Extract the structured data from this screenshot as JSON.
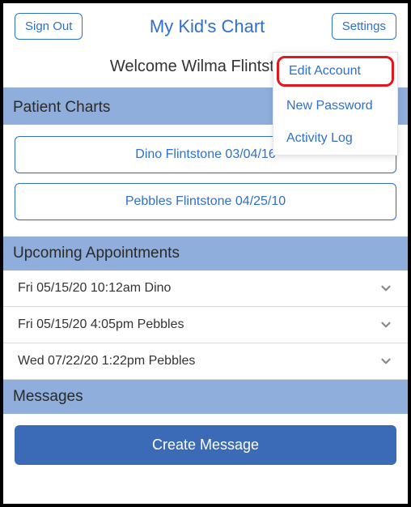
{
  "header": {
    "sign_out": "Sign Out",
    "title": "My Kid's Chart",
    "settings": "Settings"
  },
  "welcome": "Welcome Wilma Flintstone",
  "dropdown": {
    "edit_account": "Edit Account",
    "new_password": "New Password",
    "activity_log": "Activity Log"
  },
  "sections": {
    "patient_charts": "Patient Charts",
    "upcoming_appointments": "Upcoming Appointments",
    "messages": "Messages"
  },
  "patients": [
    {
      "label": "Dino Flintstone 03/04/16"
    },
    {
      "label": "Pebbles Flintstone 04/25/10"
    }
  ],
  "appointments": [
    {
      "label": "Fri 05/15/20 10:12am Dino"
    },
    {
      "label": "Fri 05/15/20 4:05pm Pebbles"
    },
    {
      "label": "Wed 07/22/20 1:22pm Pebbles"
    }
  ],
  "messages": {
    "create": "Create Message"
  }
}
